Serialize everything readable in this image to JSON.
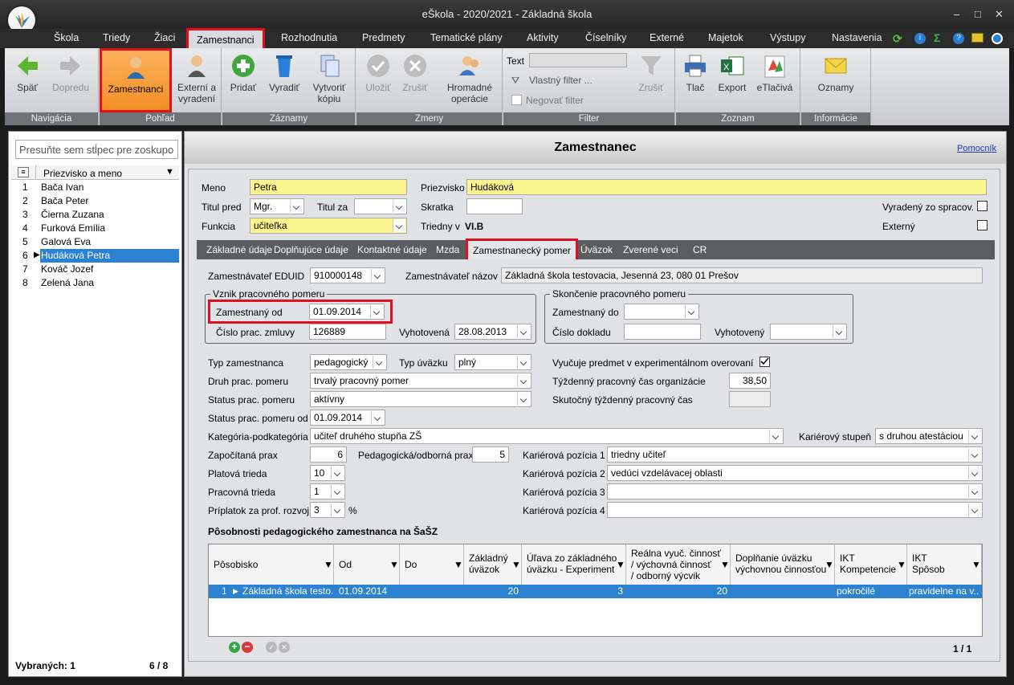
{
  "window": {
    "title": "eŠkola - 2020/2021 - Základná škola",
    "minimize": "–",
    "maximize": "□",
    "close": "✕"
  },
  "menu": [
    "Škola",
    "Triedy",
    "Žiaci",
    "Zamestnanci",
    "Rozhodnutia",
    "Predmety",
    "Tematické plány",
    "Aktivity",
    "Číselníky",
    "Externé",
    "Majetok",
    "Výstupy",
    "Nastavenia"
  ],
  "ribbon": {
    "nav": {
      "label": "Navigácia",
      "back": "Späť",
      "forward": "Dopredu"
    },
    "view": {
      "label": "Pohľad",
      "employees": "Zamestnanci",
      "external": "Externí a",
      "external2": "vyradení"
    },
    "records": {
      "label": "Záznamy",
      "add": "Pridať",
      "remove": "Vyradiť",
      "copy": "Vytvoriť",
      "copy2": "kópiu"
    },
    "changes": {
      "label": "Zmeny",
      "save": "Uložiť",
      "cancel": "Zrušiť",
      "bulk": "Hromadné",
      "bulk2": "operácie"
    },
    "filter": {
      "label": "Filter",
      "text_label": "Text",
      "own": "Vlastný filter ...",
      "negate": "Negovať filter",
      "clear": "Zrušiť"
    },
    "list": {
      "label": "Zoznam",
      "print": "Tlač",
      "export": "Export",
      "eprint": "eTlačivá"
    },
    "info": {
      "label": "Informácie",
      "notices": "Oznamy"
    }
  },
  "left": {
    "group_hint": "Presuňte sem stĺpec pre zoskupo",
    "column": "Priezvisko a meno",
    "rows": [
      {
        "n": "1",
        "name": "Bača Ivan"
      },
      {
        "n": "2",
        "name": "Bača Peter"
      },
      {
        "n": "3",
        "name": "Čierna Zuzana"
      },
      {
        "n": "4",
        "name": "Furková Emília"
      },
      {
        "n": "5",
        "name": "Galová Eva"
      },
      {
        "n": "6",
        "name": "Hudáková Petra"
      },
      {
        "n": "7",
        "name": "Kováč Jozef"
      },
      {
        "n": "8",
        "name": "Zelená Jana"
      }
    ],
    "selected_label": "Vybraných:",
    "selected_count": "1",
    "page": "6 / 8"
  },
  "main": {
    "title": "Zamestnanec",
    "help": "Pomocník",
    "meno_label": "Meno",
    "meno": "Petra",
    "priezvisko_label": "Priezvisko",
    "priezvisko": "Hudáková",
    "titul_pred_label": "Titul pred",
    "titul_pred": "Mgr.",
    "titul_za_label": "Titul za",
    "titul_za": "",
    "skratka_label": "Skratka",
    "skratka": "",
    "vyradeny_label": "Vyradený zo spracov.",
    "funkcia_label": "Funkcia",
    "funkcia": "učiteľka",
    "triedny_label": "Triedny v",
    "triedny": "VI.B",
    "externy_label": "Externý"
  },
  "tabs": [
    "Základné údaje",
    "Doplňujúce údaje",
    "Kontaktné údaje",
    "Mzda",
    "Zamestnanecký pomer",
    "Úväzok",
    "Zverené veci",
    "CR"
  ],
  "form": {
    "eduid_label": "Zamestnávateľ EDUID",
    "eduid": "910000148",
    "nazov_label": "Zamestnávateľ názov",
    "nazov": "Základná škola testovacia, Jesenná 23, 080 01 Prešov",
    "vznik_legend": "Vznik pracovného pomeru",
    "zamestnany_od_label": "Zamestnaný od",
    "zamestnany_od": "01.09.2014",
    "cislo_zmluvy_label": "Číslo prac. zmluvy",
    "cislo_zmluvy": "126889",
    "vyhotovena_label": "Vyhotovená",
    "vyhotovena": "28.08.2013",
    "skoncenie_legend": "Skončenie pracovného pomeru",
    "zamestnany_do_label": "Zamestnaný do",
    "zamestnany_do": "",
    "cislo_dokladu_label": "Číslo dokladu",
    "cislo_dokladu": "",
    "vyhotoveny_label": "Vyhotovený",
    "vyhotoveny": "",
    "typ_zam_label": "Typ zamestnanca",
    "typ_zam": "pedagogický",
    "typ_uvazku_label": "Typ úväzku",
    "typ_uvazku": "plný",
    "experiment_label": "Vyučuje predmet v experimentálnom overovaní",
    "druh_label": "Druh prac. pomeru",
    "druh": "trvalý pracovný pomer",
    "tyzdenny_label": "Týždenný pracovný čas organizácie",
    "tyzdenny": "38,50",
    "status_label": "Status prac. pomeru",
    "status": "aktívny",
    "skutocny_label": "Skutočný týždenný pracovný čas",
    "skutocny": "",
    "status_od_label": "Status prac. pomeru od",
    "status_od": "01.09.2014",
    "kategoria_label": "Kategória-podkategória",
    "kategoria": "učiteľ druhého stupňa ZŠ",
    "karierovy_stupen_label": "Kariérový stupeň",
    "karierovy_stupen": "s druhou atestáciou",
    "zapocitana_label": "Započítaná prax",
    "zapocitana": "6",
    "pedagogicka_label": "Pedagogická/odborná prax",
    "pedagogicka": "5",
    "kp1_label": "Kariérová pozícia 1",
    "kp1": "triedny učiteľ",
    "platova_label": "Platová trieda",
    "platova": "10",
    "kp2_label": "Kariérová pozícia 2",
    "kp2": "vedúci vzdelávacej oblasti",
    "pracovna_label": "Pracovná trieda",
    "pracovna": "1",
    "kp3_label": "Kariérová pozícia 3",
    "kp3": "",
    "priplatok_label": "Príplatok za prof. rozvoj",
    "priplatok": "3",
    "priplatok_unit": "%",
    "kp4_label": "Kariérová pozícia 4",
    "kp4": "",
    "posobnosti_label": "Pôsobnosti pedagogického zamestnanca na ŠaŠZ"
  },
  "grid": {
    "headers": [
      "Pôsobisko",
      "Od",
      "Do",
      "Základný\núväzok",
      "Úľava zo základného\núväzku - Experiment",
      "Reálna vyuč. činnosť\n/ výchovná činnosť\n/ odborný výcvik",
      "Doplňanie úväzku\nvýchovnou činnosťou",
      "IKT\nKompetencie",
      "IKT\nSpôsob"
    ],
    "row": {
      "n": "1",
      "posobisko": "Základná škola testo...",
      "od": "01.09.2014",
      "do": "",
      "zakladny": "20",
      "ulava": "3",
      "realna": "20",
      "doplnanie": "",
      "ikt_komp": "pokročilé",
      "ikt_sposob": "pravidelne na v..."
    },
    "pager": "1 / 1"
  },
  "colors": {
    "highlight": "#e0101f",
    "selection": "#2b82d0",
    "required": "#fbf58f"
  }
}
